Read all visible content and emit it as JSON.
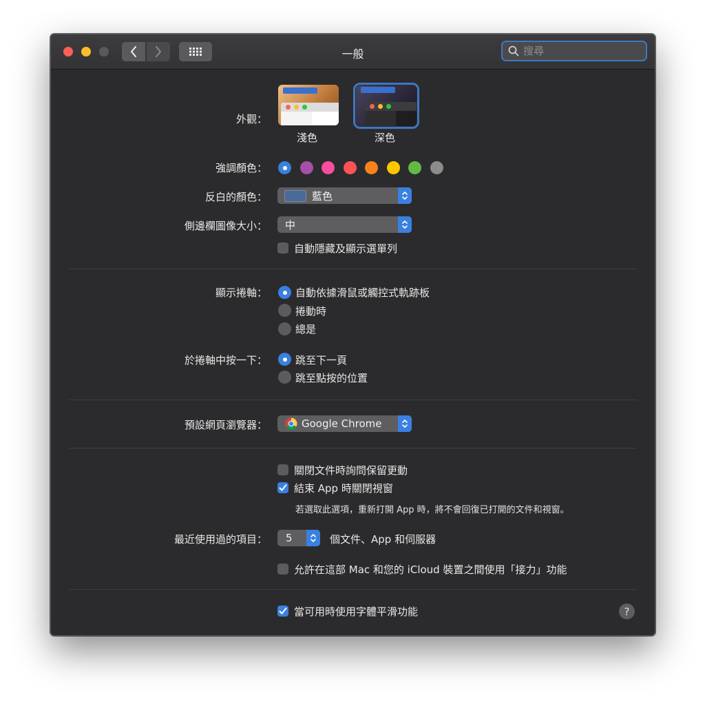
{
  "window": {
    "title": "一般"
  },
  "search": {
    "placeholder": "搜尋"
  },
  "appearance": {
    "label": "外觀：",
    "options": [
      "淺色",
      "深色"
    ],
    "selected": "深色"
  },
  "accent": {
    "label": "強調顏色：",
    "colors": [
      "#3a80e0",
      "#a550a7",
      "#f74f9e",
      "#ff5257",
      "#f7821b",
      "#ffc600",
      "#62ba46",
      "#8c8c8c"
    ],
    "selected_index": 0
  },
  "highlight": {
    "label": "反白的顏色：",
    "value": "藍色",
    "swatch": "#4a6a98"
  },
  "sidebar_icon": {
    "label": "側邊欄圖像大小：",
    "value": "中"
  },
  "autohide_menu": {
    "label": "自動隱藏及顯示選單列",
    "checked": false
  },
  "scrollbars": {
    "label": "顯示捲軸：",
    "options": [
      "自動依據滑鼠或觸控式軌跡板",
      "捲動時",
      "總是"
    ],
    "selected_index": 0
  },
  "click_scroll": {
    "label": "於捲軸中按一下：",
    "options": [
      "跳至下一頁",
      "跳至點按的位置"
    ],
    "selected_index": 0
  },
  "browser": {
    "label": "預設網頁瀏覽器：",
    "value": "Google Chrome"
  },
  "ask_keep": {
    "label": "關閉文件時詢問保留更動",
    "checked": false
  },
  "close_windows": {
    "label": "結束 App 時關閉視窗",
    "checked": true,
    "note": "若選取此選項，重新打開 App 時，將不會回復已打開的文件和視窗。"
  },
  "recent": {
    "label": "最近使用過的項目：",
    "value": "5",
    "suffix": "個文件、App 和伺服器"
  },
  "handoff": {
    "label": "允許在這部 Mac 和您的 iCloud 裝置之間使用「接力」功能",
    "checked": false
  },
  "font_smoothing": {
    "label": "當可用時使用字體平滑功能",
    "checked": true
  },
  "help": {
    "label": "?"
  }
}
